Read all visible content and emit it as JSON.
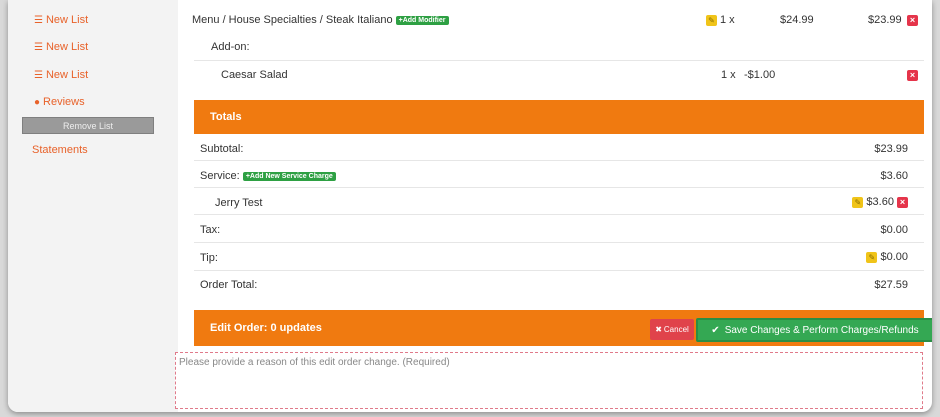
{
  "sidebar": {
    "items": [
      {
        "label": "New List",
        "icon": "list-icon"
      },
      {
        "label": "New List",
        "icon": "list-icon"
      },
      {
        "label": "New List",
        "icon": "list-icon"
      },
      {
        "label": "Reviews",
        "icon": "comments-icon"
      }
    ],
    "remove_label": "Remove List",
    "statements_label": "Statements"
  },
  "order": {
    "item_name": "Menu / House Specialties / Steak Italiano",
    "add_modifier_label": "+Add Modifier",
    "item_qty": "1 x",
    "item_price": "$24.99",
    "item_total": "$23.99",
    "addon_label": "Add-on:",
    "addon_name": "Caesar Salad",
    "addon_qty": "1 x",
    "addon_price": "-$1.00"
  },
  "totals": {
    "header": "Totals",
    "subtotal_label": "Subtotal:",
    "subtotal_value": "$23.99",
    "service_label": "Service:",
    "add_service_label": "+Add New Service Charge",
    "service_value": "$3.60",
    "service_person": "Jerry Test",
    "service_person_value": "$3.60",
    "tax_label": "Tax:",
    "tax_value": "$0.00",
    "tip_label": "Tip:",
    "tip_value": "$0.00",
    "order_total_label": "Order Total:",
    "order_total_value": "$27.59"
  },
  "edit_order": {
    "header": "Edit Order: 0 updates",
    "cancel_label": "Cancel",
    "save_label": "Save Changes & Perform Charges/Refunds",
    "reason_placeholder": "Please provide a reason of this edit order change. (Required)"
  },
  "colors": {
    "accent_orange": "#f07a10",
    "link_orange": "#e8622a",
    "success_green": "#34a853",
    "danger_red": "#e0434b"
  }
}
